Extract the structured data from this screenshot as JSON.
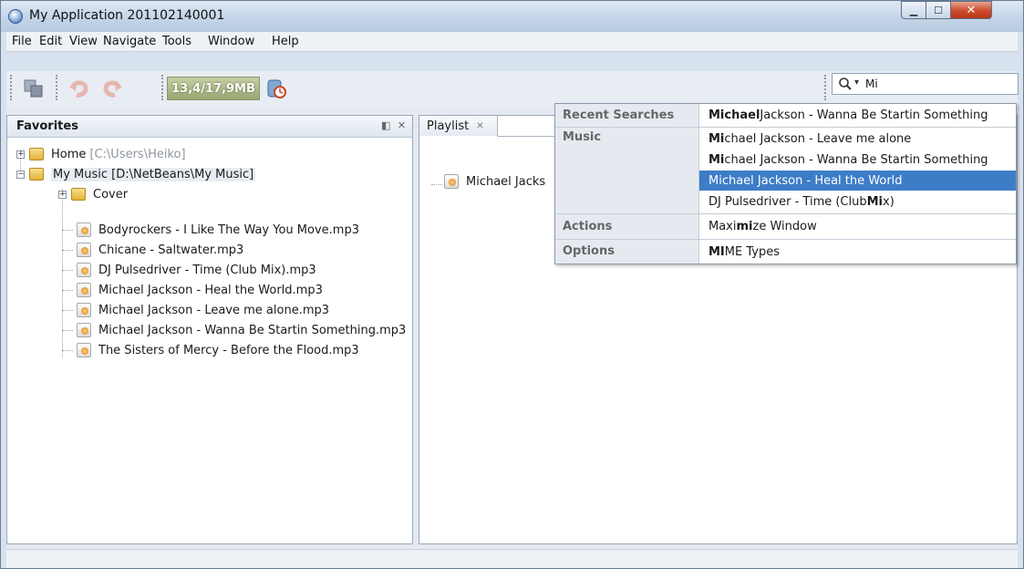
{
  "window": {
    "title": "My Application 201102140001",
    "min_icon": "minimize-icon",
    "max_icon": "maximize-icon",
    "close_icon": "close-icon"
  },
  "menu": [
    "File",
    "Edit",
    "View",
    "Navigate",
    "Tools",
    "Window",
    "Help"
  ],
  "toolbar": {
    "memory_label": "13,4/17,9MB",
    "search_value": "Mi",
    "icons": [
      "cut-paste-icon",
      "undo-icon",
      "redo-icon",
      "garbage-collect-icon",
      "search-icon"
    ]
  },
  "favorites": {
    "title": "Favorites",
    "tree": [
      {
        "label": "Home",
        "path": "[C:\\Users\\Heiko]"
      },
      {
        "label": "My Music [D:\\NetBeans\\My Music]"
      },
      {
        "label": "Cover"
      },
      {
        "label": "Bodyrockers - I Like The Way You Move.mp3"
      },
      {
        "label": "Chicane - Saltwater.mp3"
      },
      {
        "label": "DJ Pulsedriver - Time (Club Mix).mp3"
      },
      {
        "label": "Michael Jackson - Heal the World.mp3"
      },
      {
        "label": "Michael Jackson - Leave me alone.mp3"
      },
      {
        "label": "Michael Jackson - Wanna Be Startin Something.mp3"
      },
      {
        "label": "The Sisters of Mercy - Before the Flood.mp3"
      }
    ]
  },
  "playlist": {
    "tab": "Playlist",
    "item": "Michael Jacks"
  },
  "quick_search": {
    "categories": [
      "Recent Searches",
      "Music",
      "Actions",
      "Options"
    ],
    "recent": [
      {
        "bold": "Michael",
        "rest": " Jackson - Wanna Be Startin Something"
      }
    ],
    "music": [
      {
        "pre": "",
        "bold": "Mi",
        "rest": "chael Jackson - Leave me alone"
      },
      {
        "pre": "",
        "bold": "Mi",
        "rest": "chael Jackson - Wanna Be Startin Something"
      },
      {
        "pre": "",
        "bold": "Mi",
        "rest": "chael Jackson - Heal the World"
      },
      {
        "pre": "DJ Pulsedriver - Time (Club ",
        "bold": "Mi",
        "rest": "x)"
      }
    ],
    "actions": [
      {
        "pre": "Maxi",
        "bold": "mi",
        "rest": "ze Window"
      }
    ],
    "options": [
      {
        "pre": "",
        "bold": "MI",
        "rest": "ME Types"
      }
    ],
    "selected_color": "#3d7dc7"
  }
}
